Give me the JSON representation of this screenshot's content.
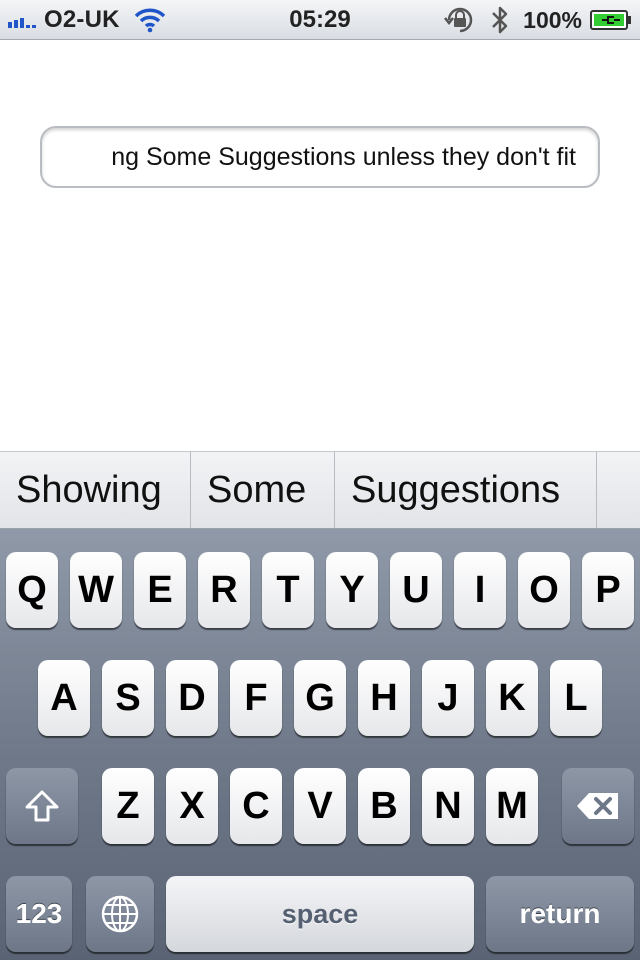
{
  "status_bar": {
    "carrier": "O2-UK",
    "time": "05:29",
    "battery_percent": "100%",
    "icons": [
      "signal-icon",
      "wifi-icon",
      "orientation-lock-icon",
      "bluetooth-icon",
      "battery-charging-icon"
    ]
  },
  "text_field": {
    "value": "ng Some Suggestions unless they don't fit"
  },
  "suggestions": [
    "Showing",
    "Some",
    "Suggestions"
  ],
  "keyboard": {
    "row1": [
      "Q",
      "W",
      "E",
      "R",
      "T",
      "Y",
      "U",
      "I",
      "O",
      "P"
    ],
    "row2": [
      "A",
      "S",
      "D",
      "F",
      "G",
      "H",
      "J",
      "K",
      "L"
    ],
    "row3": [
      "Z",
      "X",
      "C",
      "V",
      "B",
      "N",
      "M"
    ],
    "numbers_label": "123",
    "space_label": "space",
    "return_label": "return",
    "icons": [
      "shift-icon",
      "backspace-icon",
      "globe-icon"
    ]
  },
  "colors": {
    "signal_blue": "#1f55c8",
    "keyboard_bg": "#707a8a",
    "charging_green": "#33cc33"
  }
}
